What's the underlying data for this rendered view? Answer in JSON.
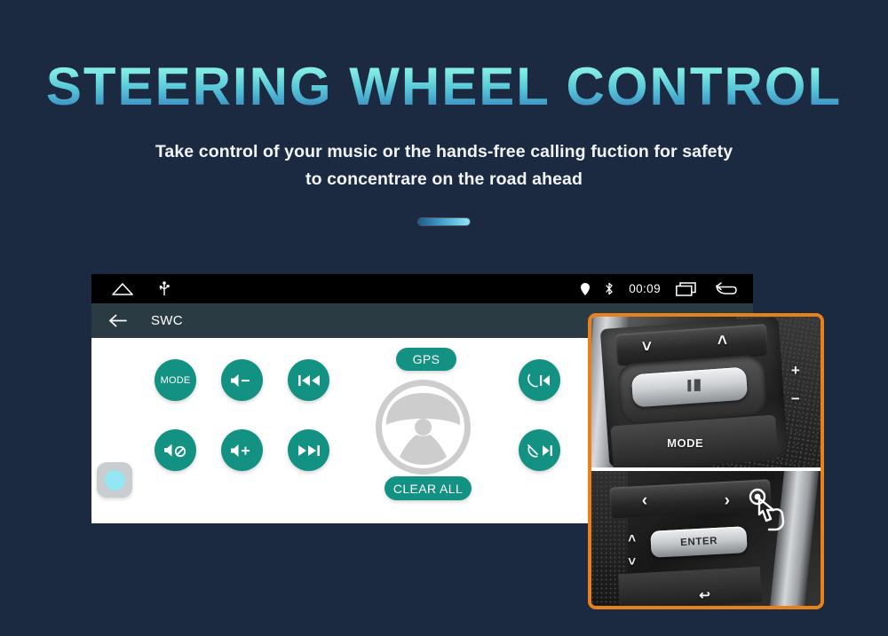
{
  "page": {
    "background_color": "#1b2a40",
    "accent_color": "#139284",
    "frame_color": "#e8801c"
  },
  "hero": {
    "title": "STEERING WHEEL CONTROL",
    "subtitle_line1": "Take control of your music or the hands-free calling fuction for safety",
    "subtitle_line2": "to concentrare on the road ahead",
    "divider": "gradient-divider"
  },
  "device": {
    "status_bar": {
      "left_icons": [
        "home-icon",
        "usb-icon"
      ],
      "right_icons": [
        "location-pin-icon",
        "bluetooth-icon"
      ],
      "time": "00:09",
      "trailing_icons": [
        "recents-icon",
        "back-arrow-icon"
      ]
    },
    "app_bar": {
      "back_icon": "back-arrow-icon",
      "title": "SWC"
    },
    "buttons": {
      "mode": "MODE",
      "volume_down": "volume-down-icon",
      "previous_track": "previous-track-icon",
      "mute": "volume-mute-icon",
      "volume_up": "volume-up-icon",
      "next_track": "next-track-icon",
      "call_answer_previous": "call-answer-previous-icon",
      "call_end_next": "call-end-next-icon"
    },
    "gps_label": "GPS",
    "clear_all_label": "CLEAR ALL",
    "wheel": "steering-wheel-illustration",
    "toggle": "learn-toggle"
  },
  "photos": {
    "top": {
      "mode_label": "MODE",
      "plus_label": "+",
      "minus_label": "−",
      "chevron_down": "chevron-down-icon",
      "chevron_up": "chevron-up-icon",
      "rocker_icon": "volume-rocker-icon"
    },
    "bottom": {
      "enter_label": "ENTER",
      "chevron_left": "chevron-left-icon",
      "chevron_right": "chevron-right-icon",
      "chevron_up": "chevron-up-icon",
      "chevron_down": "chevron-down-icon",
      "back_icon": "back-arrow-icon",
      "cursor": "hand-pointer-icon"
    }
  }
}
